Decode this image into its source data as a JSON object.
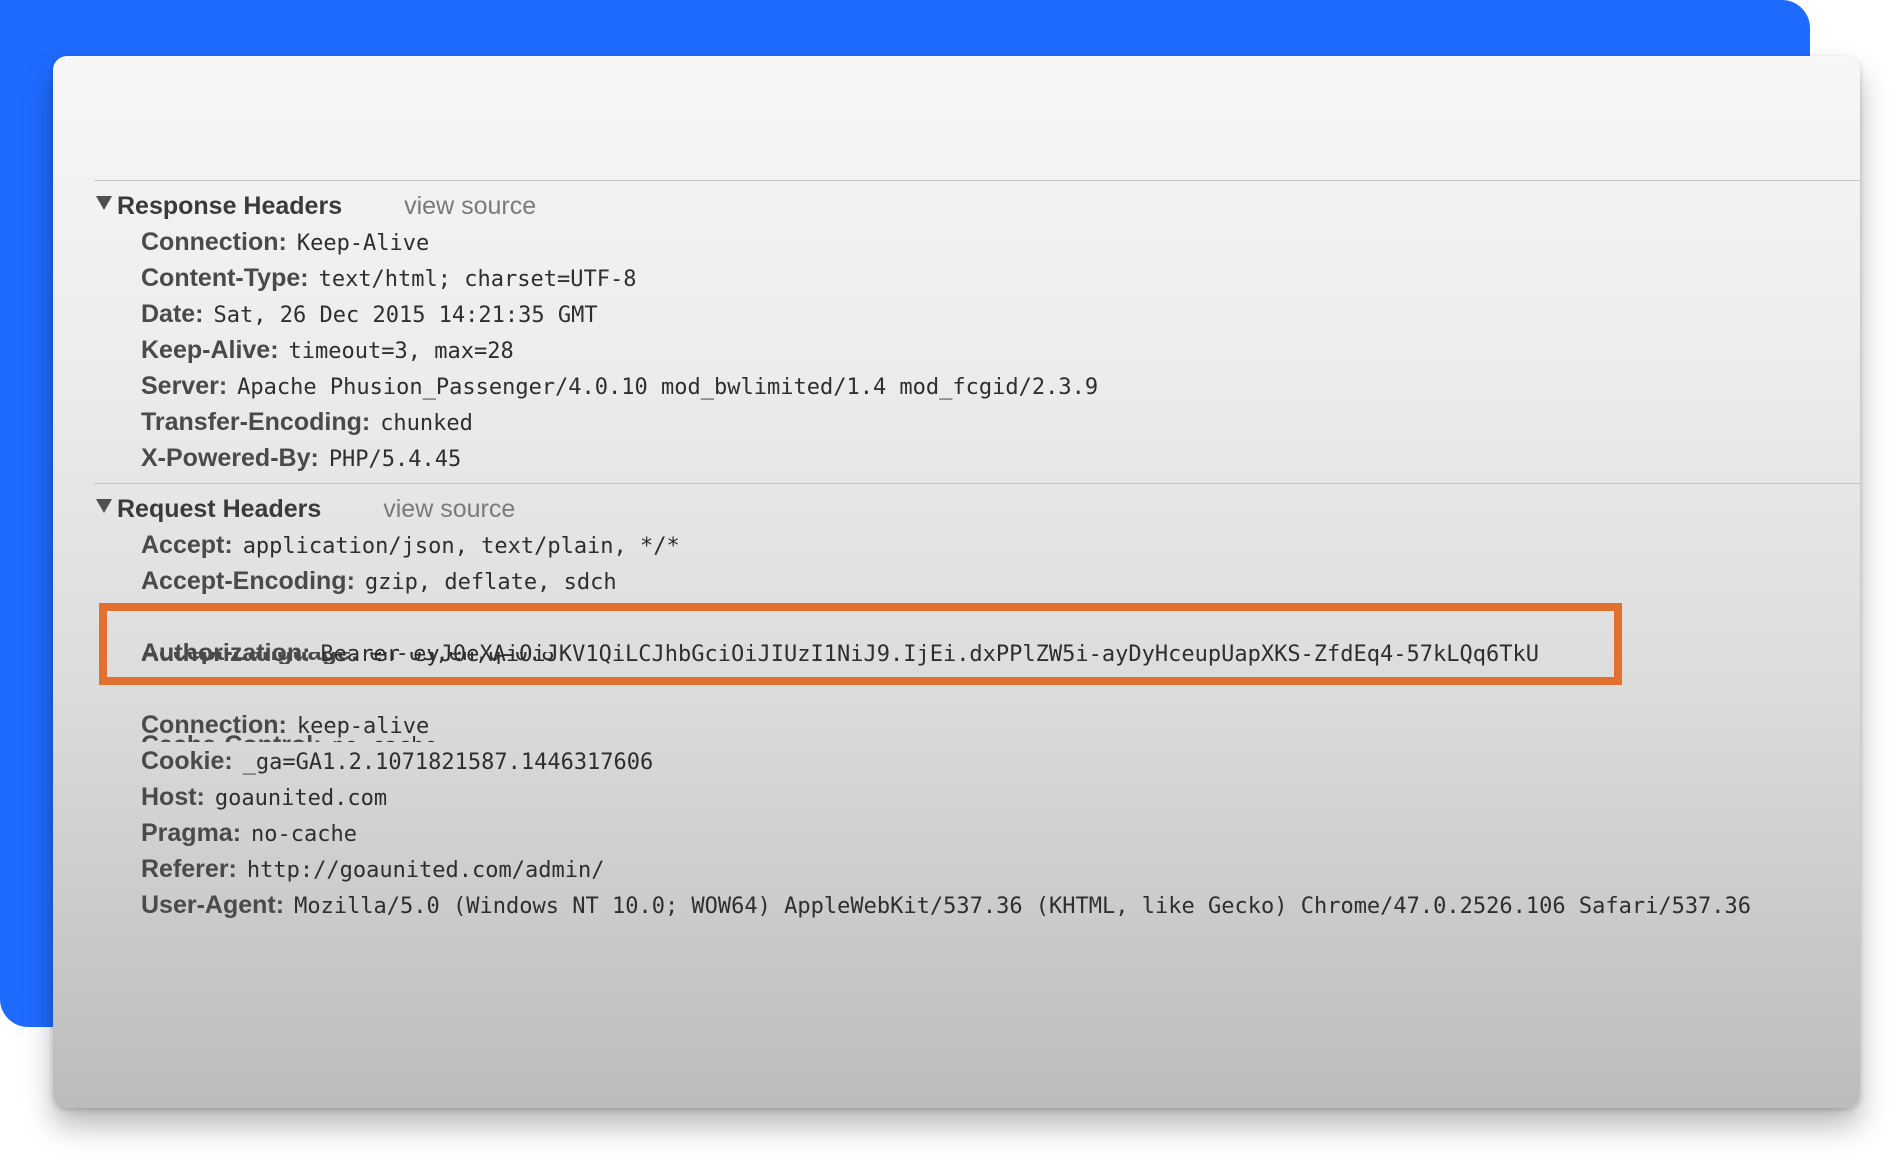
{
  "response_section": {
    "title": "Response Headers",
    "view_source": "view source",
    "headers": [
      {
        "name": "Connection:",
        "value": "Keep-Alive"
      },
      {
        "name": "Content-Type:",
        "value": "text/html; charset=UTF-8"
      },
      {
        "name": "Date:",
        "value": "Sat, 26 Dec 2015 14:21:35 GMT"
      },
      {
        "name": "Keep-Alive:",
        "value": "timeout=3, max=28"
      },
      {
        "name": "Server:",
        "value": "Apache Phusion_Passenger/4.0.10 mod_bwlimited/1.4 mod_fcgid/2.3.9"
      },
      {
        "name": "Transfer-Encoding:",
        "value": "chunked"
      },
      {
        "name": "X-Powered-By:",
        "value": "PHP/5.4.45"
      }
    ]
  },
  "request_section": {
    "title": "Request Headers",
    "view_source": "view source",
    "headers": [
      {
        "name": "Accept:",
        "value": "application/json, text/plain, */*"
      },
      {
        "name": "Accept-Encoding:",
        "value": "gzip, deflate, sdch"
      },
      {
        "name": "Accept-Language:",
        "value": "en-US,en;q=0.8"
      },
      {
        "name": "Authorization:",
        "value": "Bearer eyJ0eXAiOiJKV1QiLCJhbGciOiJIUzI1NiJ9.IjEi.dxPPlZW5i-ayDyHceupUapXKS-ZfdEq4-57kLQq6TkU"
      },
      {
        "name": "Cache-Control:",
        "value": "no-cache"
      },
      {
        "name": "Connection:",
        "value": "keep-alive"
      },
      {
        "name": "Cookie:",
        "value": "_ga=GA1.2.1071821587.1446317606"
      },
      {
        "name": "Host:",
        "value": "goaunited.com"
      },
      {
        "name": "Pragma:",
        "value": "no-cache"
      },
      {
        "name": "Referer:",
        "value": "http://goaunited.com/admin/"
      },
      {
        "name": "User-Agent:",
        "value": "Mozilla/5.0 (Windows NT 10.0; WOW64) AppleWebKit/537.36 (KHTML, like Gecko) Chrome/47.0.2526.106 Safari/537.36"
      }
    ]
  },
  "colors": {
    "background_accent": "#1f6bff",
    "highlight_border": "#e2702f"
  }
}
